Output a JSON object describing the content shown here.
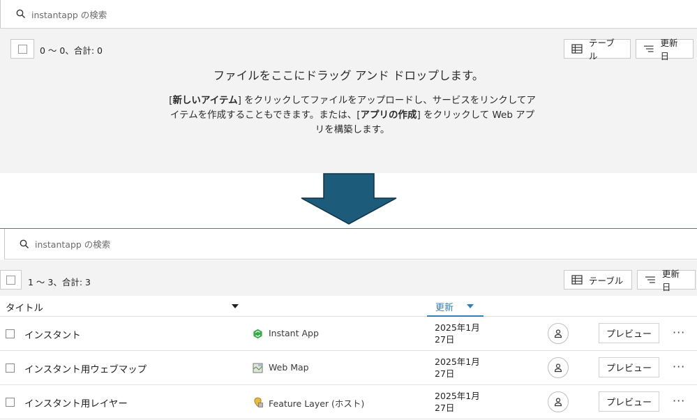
{
  "top": {
    "search_placeholder": "instantapp の検索",
    "count": "0 〜 0、合計: 0",
    "table_button": "テーブル",
    "sort_button": "更新日",
    "drop_title": "ファイルをここにドラッグ アンド ドロップします。",
    "drop_desc": {
      "p1_open": "[",
      "p1_bold": "新しいアイテム",
      "p1_rest": "] をクリックしてファイルをアップロードし、サービスをリンクしてアイテムを作成することもできます。または、[",
      "p2_bold": "アプリの作成",
      "p2_rest": "] をクリックして Web アプリを構築します。"
    }
  },
  "bottom": {
    "search_placeholder": "instantapp の検索",
    "count": "1 〜 3、合計: 3",
    "table_button": "テーブル",
    "sort_button": "更新日",
    "columns": {
      "title": "タイトル",
      "updated": "更新"
    },
    "rows": [
      {
        "title": "インスタント",
        "type": "Instant App",
        "type_icon": "instant-app-icon",
        "date_line1": "2025年1月",
        "date_line2": "27日",
        "preview": "プレビュー"
      },
      {
        "title": "インスタント用ウェブマップ",
        "type": "Web Map",
        "type_icon": "web-map-icon",
        "date_line1": "2025年1月",
        "date_line2": "27日",
        "preview": "プレビュー"
      },
      {
        "title": "インスタント用レイヤー",
        "type": "Feature Layer (ホスト)",
        "type_icon": "feature-layer-icon",
        "date_line1": "2025年1月",
        "date_line2": "27日",
        "preview": "プレビュー"
      }
    ]
  },
  "colors": {
    "accent": "#2f7fb8",
    "arrow": "#1d5b7a",
    "panel_bg": "#f3f3f3"
  }
}
